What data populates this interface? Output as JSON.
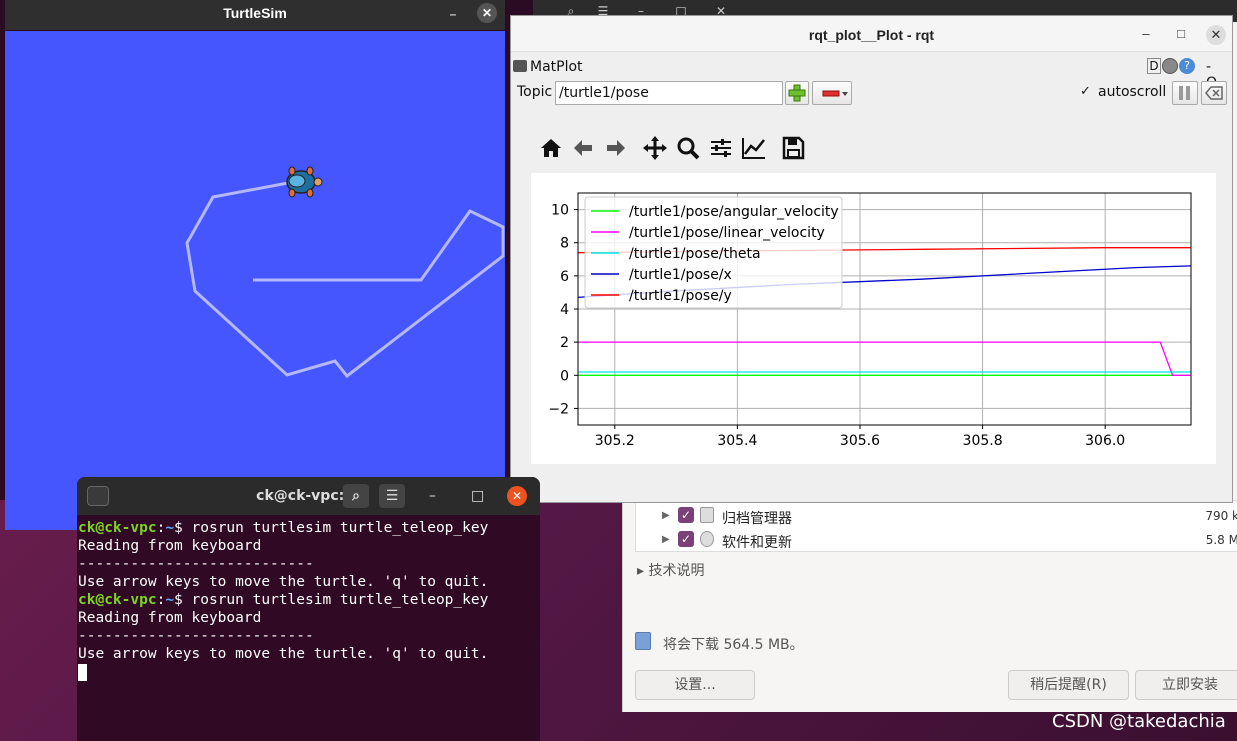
{
  "turtlesim": {
    "title": "TurtleSim"
  },
  "rqt": {
    "title": "rqt_plot__Plot - rqt",
    "plugin_name": "MatPlot",
    "plugin_controls": "D",
    "plugin_min": "- O",
    "topic_label": "Topic",
    "topic_value": "/turtle1/pose",
    "autoscroll_label": "autoscroll",
    "autoscroll_checked": "✓"
  },
  "chart_data": {
    "type": "line",
    "xlim": [
      305.14,
      306.14
    ],
    "ylim": [
      -3.0,
      11.0
    ],
    "xticks": [
      305.2,
      305.4,
      305.6,
      305.8,
      306.0
    ],
    "xtick_labels": [
      "305.2",
      "305.4",
      "305.6",
      "305.8",
      "306.0"
    ],
    "yticks": [
      -2,
      0,
      2,
      4,
      6,
      8,
      10
    ],
    "ytick_labels": [
      "−2",
      "0",
      "2",
      "4",
      "6",
      "8",
      "10"
    ],
    "grid": true,
    "legend_position": "top-left",
    "series": [
      {
        "name": "/turtle1/pose/angular_velocity",
        "color": "#00ff00",
        "x": [
          305.14,
          306.14
        ],
        "y": [
          0.0,
          0.0
        ]
      },
      {
        "name": "/turtle1/pose/linear_velocity",
        "color": "#ff00ff",
        "x": [
          305.14,
          306.09,
          306.11,
          306.14
        ],
        "y": [
          2.0,
          2.0,
          0.0,
          0.0
        ]
      },
      {
        "name": "/turtle1/pose/theta",
        "color": "#00e5e5",
        "x": [
          305.14,
          306.14
        ],
        "y": [
          0.2,
          0.2
        ]
      },
      {
        "name": "/turtle1/pose/x",
        "color": "#0000cc",
        "x": [
          305.14,
          305.3,
          305.5,
          305.7,
          305.9,
          306.05,
          306.14
        ],
        "y": [
          4.7,
          5.1,
          5.5,
          5.8,
          6.2,
          6.5,
          6.6
        ]
      },
      {
        "name": "/turtle1/pose/y",
        "color": "#ff0000",
        "x": [
          305.14,
          305.4,
          305.7,
          306.0,
          306.14
        ],
        "y": [
          7.4,
          7.5,
          7.6,
          7.7,
          7.7
        ]
      }
    ]
  },
  "terminal": {
    "title": "ck@ck-vpc: ~",
    "prompt_user": "ck@ck-vpc",
    "prompt_sep": ":",
    "prompt_path": "~",
    "prompt_end": "$ ",
    "command": "rosrun turtlesim turtle_teleop_key",
    "out1": "Reading from keyboard",
    "out2": "---------------------------",
    "out3": "Use arrow keys to move the turtle. 'q' to quit."
  },
  "updater": {
    "item1_name": "归档管理器",
    "item1_size": "790 k",
    "item2_name": "软件和更新",
    "item2_size": "5.8 M",
    "tech_label": "技术说明",
    "download_text": "将会下载 564.5 MB。",
    "settings_button": "设置...",
    "remind_button": "稍后提醒(R)",
    "install_button": "立即安装"
  },
  "watermark": "CSDN @takedachia"
}
